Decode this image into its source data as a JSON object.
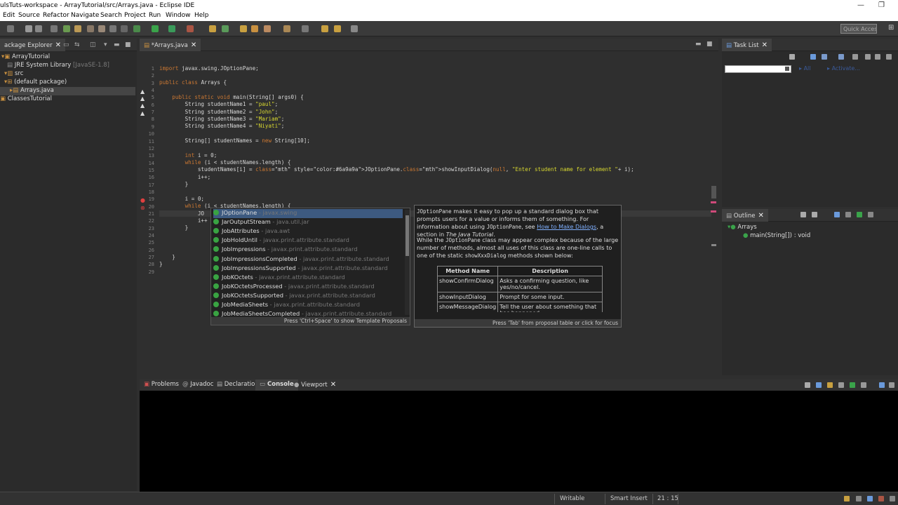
{
  "window": {
    "title": "ulsTuts-workspace - ArrayTutorial/src/Arrays.java - Eclipse IDE"
  },
  "menu": [
    "Edit",
    "Source",
    "Refactor",
    "Navigate",
    "Search",
    "Project",
    "Run",
    "Window",
    "Help"
  ],
  "quick_access": {
    "placeholder": "Quick Access"
  },
  "package_explorer": {
    "tab": "ackage Explorer",
    "items": [
      {
        "label": "ArrayTutorial",
        "extra": ""
      },
      {
        "label": "JRE System Library",
        "extra": "[JavaSE-1.8]"
      },
      {
        "label": "src",
        "extra": ""
      },
      {
        "label": "(default package)",
        "extra": ""
      },
      {
        "label": "Arrays.java",
        "extra": ""
      },
      {
        "label": "ClassesTutorial",
        "extra": ""
      }
    ]
  },
  "editor": {
    "tab": "*Arrays.java",
    "lines": [
      {
        "n": "1",
        "text": "import javax.swing.JOptionPane;"
      },
      {
        "n": "2",
        "text": ""
      },
      {
        "n": "3",
        "text": "public class Arrays {"
      },
      {
        "n": "4",
        "text": ""
      },
      {
        "n": "5",
        "text": "    public static void main(String[] args0) {"
      },
      {
        "n": "6",
        "text": "        String studentName1 = \"paul\";"
      },
      {
        "n": "7",
        "text": "        String studentName2 = \"John\";"
      },
      {
        "n": "8",
        "text": "        String studentName3 = \"Mariam\";"
      },
      {
        "n": "9",
        "text": "        String studentName4 = \"Niyati\";"
      },
      {
        "n": "10",
        "text": ""
      },
      {
        "n": "11",
        "text": "        String[] studentNames = new String[10];"
      },
      {
        "n": "12",
        "text": ""
      },
      {
        "n": "13",
        "text": "        int i = 0;"
      },
      {
        "n": "14",
        "text": "        while (i < studentNames.length) {"
      },
      {
        "n": "15",
        "text": "            studentNames[i] = JOptionPane.showInputDialog(null, \"Enter student name for element \"+ i);"
      },
      {
        "n": "16",
        "text": "            i++;"
      },
      {
        "n": "17",
        "text": "        }"
      },
      {
        "n": "18",
        "text": ""
      },
      {
        "n": "19",
        "text": "        i = 0;"
      },
      {
        "n": "20",
        "text": "        while (i < studentNames.length) {"
      },
      {
        "n": "21",
        "text": "            JO"
      },
      {
        "n": "22",
        "text": "            i++"
      },
      {
        "n": "23",
        "text": "        }"
      },
      {
        "n": "24",
        "text": ""
      },
      {
        "n": "25",
        "text": ""
      },
      {
        "n": "26",
        "text": ""
      },
      {
        "n": "27",
        "text": "    }"
      },
      {
        "n": "28",
        "text": "}"
      },
      {
        "n": "29",
        "text": ""
      }
    ]
  },
  "proposals": {
    "items": [
      {
        "name": "JOptionPane",
        "pkg": "javax.swing"
      },
      {
        "name": "JarOutputStream",
        "pkg": "java.util.jar"
      },
      {
        "name": "JobAttributes",
        "pkg": "java.awt"
      },
      {
        "name": "JobHoldUntil",
        "pkg": "javax.print.attribute.standard"
      },
      {
        "name": "JobImpressions",
        "pkg": "javax.print.attribute.standard"
      },
      {
        "name": "JobImpressionsCompleted",
        "pkg": "javax.print.attribute.standard"
      },
      {
        "name": "JobImpressionsSupported",
        "pkg": "javax.print.attribute.standard"
      },
      {
        "name": "JobKOctets",
        "pkg": "javax.print.attribute.standard"
      },
      {
        "name": "JobKOctetsProcessed",
        "pkg": "javax.print.attribute.standard"
      },
      {
        "name": "JobKOctetsSupported",
        "pkg": "javax.print.attribute.standard"
      },
      {
        "name": "JobMediaSheets",
        "pkg": "javax.print.attribute.standard"
      },
      {
        "name": "JobMediaSheetsCompleted",
        "pkg": "javax.print.attribute.standard"
      }
    ],
    "footer": "Press 'Ctrl+Space' to show Template Proposals"
  },
  "doc": {
    "p1_code": "JOptionPane",
    "p1_a": " makes it easy to pop up a standard dialog box that prompts users for a value or informs them of something. For information about using ",
    "p1_code2": "JOptionPane",
    "p1_b": ", see ",
    "p1_link": "How to Make Dialogs",
    "p1_c": ", a section in ",
    "p1_em": "The Java Tutorial",
    "p1_d": ".",
    "p2_a": "While the ",
    "p2_code": "JOptionPane",
    "p2_b": " class may appear complex because of the large number of methods, almost all uses of this class are one-line calls to one of the static ",
    "p2_code2": "showXxxDialog",
    "p2_c": " methods shown below:",
    "table_headers": [
      "Method Name",
      "Description"
    ],
    "rows": [
      [
        "showConfirmDialog",
        "Asks a confirming question, like yes/no/cancel."
      ],
      [
        "showInputDialog",
        "Prompt for some input."
      ],
      [
        "showMessageDialog",
        "Tell the user about something that has happened."
      ]
    ],
    "footer": "Press 'Tab' from proposal table or click for focus"
  },
  "task_list": {
    "tab": "Task List",
    "filter_all": "All",
    "filter_activate": "Activate..."
  },
  "outline": {
    "tab": "Outline",
    "class": "Arrays",
    "method": "main(String[]) : void"
  },
  "bottom_tabs": [
    "Problems",
    "Javadoc",
    "Declaration",
    "Console",
    "Viewport"
  ],
  "status": {
    "writable": "Writable",
    "insert": "Smart Insert",
    "position": "21 : 15"
  }
}
